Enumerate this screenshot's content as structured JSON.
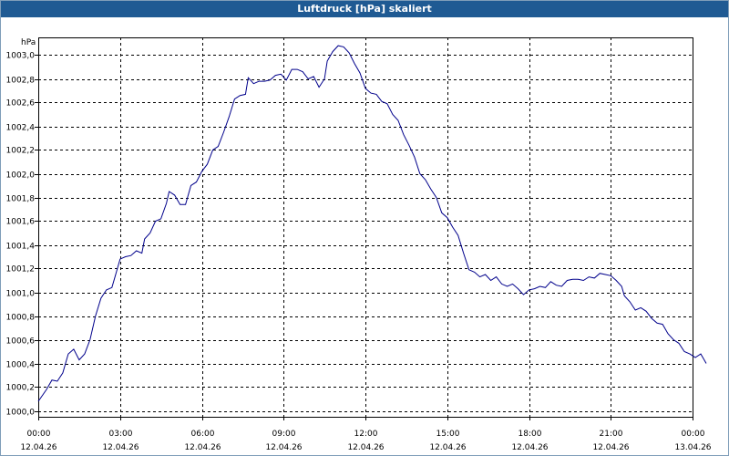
{
  "window": {
    "title": "Luftdruck [hPa] skaliert"
  },
  "chart_data": {
    "type": "line",
    "title": "Luftdruck [hPa] skaliert",
    "ylabel": "hPa",
    "xlabel": "",
    "ylim": [
      999.95,
      1003.15
    ],
    "xlim": [
      0,
      24
    ],
    "grid": true,
    "y_ticks": [
      {
        "value": 1000.0,
        "label": "1000,0"
      },
      {
        "value": 1000.2,
        "label": "1000,2"
      },
      {
        "value": 1000.4,
        "label": "1000,4"
      },
      {
        "value": 1000.6,
        "label": "1000,6"
      },
      {
        "value": 1000.8,
        "label": "1000,8"
      },
      {
        "value": 1001.0,
        "label": "1001,0"
      },
      {
        "value": 1001.2,
        "label": "1001,2"
      },
      {
        "value": 1001.4,
        "label": "1001,4"
      },
      {
        "value": 1001.6,
        "label": "1001,6"
      },
      {
        "value": 1001.8,
        "label": "1001,8"
      },
      {
        "value": 1002.0,
        "label": "1002,0"
      },
      {
        "value": 1002.2,
        "label": "1002,2"
      },
      {
        "value": 1002.4,
        "label": "1002,4"
      },
      {
        "value": 1002.6,
        "label": "1002,6"
      },
      {
        "value": 1002.8,
        "label": "1002,8"
      },
      {
        "value": 1003.0,
        "label": "1003,0"
      }
    ],
    "x_ticks": [
      {
        "value": 0,
        "time": "00:00",
        "date": "12.04.26"
      },
      {
        "value": 3,
        "time": "03:00",
        "date": "12.04.26"
      },
      {
        "value": 6,
        "time": "06:00",
        "date": "12.04.26"
      },
      {
        "value": 9,
        "time": "09:00",
        "date": "12.04.26"
      },
      {
        "value": 12,
        "time": "12:00",
        "date": "12.04.26"
      },
      {
        "value": 15,
        "time": "15:00",
        "date": "12.04.26"
      },
      {
        "value": 18,
        "time": "18:00",
        "date": "12.04.26"
      },
      {
        "value": 21,
        "time": "21:00",
        "date": "12.04.26"
      },
      {
        "value": 24,
        "time": "00:00",
        "date": "13.04.26"
      }
    ],
    "series": [
      {
        "color": "#00008b",
        "points": [
          [
            0.0,
            1000.08
          ],
          [
            0.3,
            1000.18
          ],
          [
            0.5,
            1000.26
          ],
          [
            0.7,
            1000.25
          ],
          [
            0.9,
            1000.32
          ],
          [
            1.1,
            1000.48
          ],
          [
            1.3,
            1000.52
          ],
          [
            1.5,
            1000.43
          ],
          [
            1.7,
            1000.48
          ],
          [
            1.9,
            1000.6
          ],
          [
            2.1,
            1000.8
          ],
          [
            2.3,
            1000.95
          ],
          [
            2.5,
            1001.02
          ],
          [
            2.7,
            1001.04
          ],
          [
            2.9,
            1001.2
          ],
          [
            3.0,
            1001.28
          ],
          [
            3.2,
            1001.3
          ],
          [
            3.4,
            1001.31
          ],
          [
            3.6,
            1001.35
          ],
          [
            3.8,
            1001.33
          ],
          [
            3.9,
            1001.45
          ],
          [
            4.1,
            1001.5
          ],
          [
            4.3,
            1001.6
          ],
          [
            4.5,
            1001.62
          ],
          [
            4.7,
            1001.75
          ],
          [
            4.8,
            1001.85
          ],
          [
            5.0,
            1001.82
          ],
          [
            5.2,
            1001.74
          ],
          [
            5.4,
            1001.74
          ],
          [
            5.6,
            1001.9
          ],
          [
            5.8,
            1001.93
          ],
          [
            6.0,
            1002.02
          ],
          [
            6.2,
            1002.08
          ],
          [
            6.4,
            1002.2
          ],
          [
            6.6,
            1002.23
          ],
          [
            6.8,
            1002.35
          ],
          [
            7.0,
            1002.48
          ],
          [
            7.2,
            1002.63
          ],
          [
            7.4,
            1002.66
          ],
          [
            7.6,
            1002.67
          ],
          [
            7.7,
            1002.81
          ],
          [
            7.9,
            1002.76
          ],
          [
            8.1,
            1002.78
          ],
          [
            8.3,
            1002.78
          ],
          [
            8.5,
            1002.79
          ],
          [
            8.7,
            1002.83
          ],
          [
            8.9,
            1002.84
          ],
          [
            9.1,
            1002.79
          ],
          [
            9.3,
            1002.88
          ],
          [
            9.5,
            1002.88
          ],
          [
            9.7,
            1002.86
          ],
          [
            9.9,
            1002.8
          ],
          [
            10.1,
            1002.82
          ],
          [
            10.3,
            1002.73
          ],
          [
            10.5,
            1002.8
          ],
          [
            10.6,
            1002.95
          ],
          [
            10.8,
            1003.03
          ],
          [
            11.0,
            1003.08
          ],
          [
            11.2,
            1003.07
          ],
          [
            11.4,
            1003.02
          ],
          [
            11.6,
            1002.93
          ],
          [
            11.8,
            1002.85
          ],
          [
            12.0,
            1002.72
          ],
          [
            12.2,
            1002.68
          ],
          [
            12.4,
            1002.67
          ],
          [
            12.6,
            1002.61
          ],
          [
            12.8,
            1002.59
          ],
          [
            13.0,
            1002.5
          ],
          [
            13.2,
            1002.45
          ],
          [
            13.4,
            1002.33
          ],
          [
            13.6,
            1002.24
          ],
          [
            13.8,
            1002.14
          ],
          [
            14.0,
            1002.0
          ],
          [
            14.2,
            1001.95
          ],
          [
            14.4,
            1001.87
          ],
          [
            14.6,
            1001.8
          ],
          [
            14.8,
            1001.67
          ],
          [
            15.0,
            1001.63
          ],
          [
            15.2,
            1001.55
          ],
          [
            15.4,
            1001.48
          ],
          [
            15.6,
            1001.33
          ],
          [
            15.8,
            1001.19
          ],
          [
            16.0,
            1001.17
          ],
          [
            16.2,
            1001.13
          ],
          [
            16.4,
            1001.15
          ],
          [
            16.6,
            1001.1
          ],
          [
            16.8,
            1001.13
          ],
          [
            17.0,
            1001.07
          ],
          [
            17.2,
            1001.05
          ],
          [
            17.4,
            1001.07
          ],
          [
            17.6,
            1001.03
          ],
          [
            17.8,
            1000.98
          ],
          [
            18.0,
            1001.02
          ],
          [
            18.2,
            1001.03
          ],
          [
            18.4,
            1001.05
          ],
          [
            18.6,
            1001.04
          ],
          [
            18.8,
            1001.09
          ],
          [
            19.0,
            1001.06
          ],
          [
            19.2,
            1001.05
          ],
          [
            19.4,
            1001.1
          ],
          [
            19.6,
            1001.11
          ],
          [
            19.8,
            1001.11
          ],
          [
            20.0,
            1001.1
          ],
          [
            20.2,
            1001.13
          ],
          [
            20.4,
            1001.12
          ],
          [
            20.6,
            1001.16
          ],
          [
            20.8,
            1001.15
          ],
          [
            21.0,
            1001.14
          ],
          [
            21.2,
            1001.1
          ],
          [
            21.4,
            1001.05
          ],
          [
            21.5,
            1000.97
          ],
          [
            21.7,
            1000.92
          ],
          [
            21.9,
            1000.85
          ],
          [
            22.1,
            1000.87
          ],
          [
            22.3,
            1000.84
          ],
          [
            22.5,
            1000.78
          ],
          [
            22.7,
            1000.74
          ],
          [
            22.9,
            1000.73
          ],
          [
            23.1,
            1000.65
          ],
          [
            23.3,
            1000.6
          ],
          [
            23.5,
            1000.57
          ],
          [
            23.7,
            1000.5
          ],
          [
            23.9,
            1000.48
          ],
          [
            24.1,
            1000.45
          ],
          [
            24.3,
            1000.48
          ],
          [
            24.4,
            1000.44
          ],
          [
            24.5,
            1000.4
          ]
        ]
      }
    ]
  }
}
